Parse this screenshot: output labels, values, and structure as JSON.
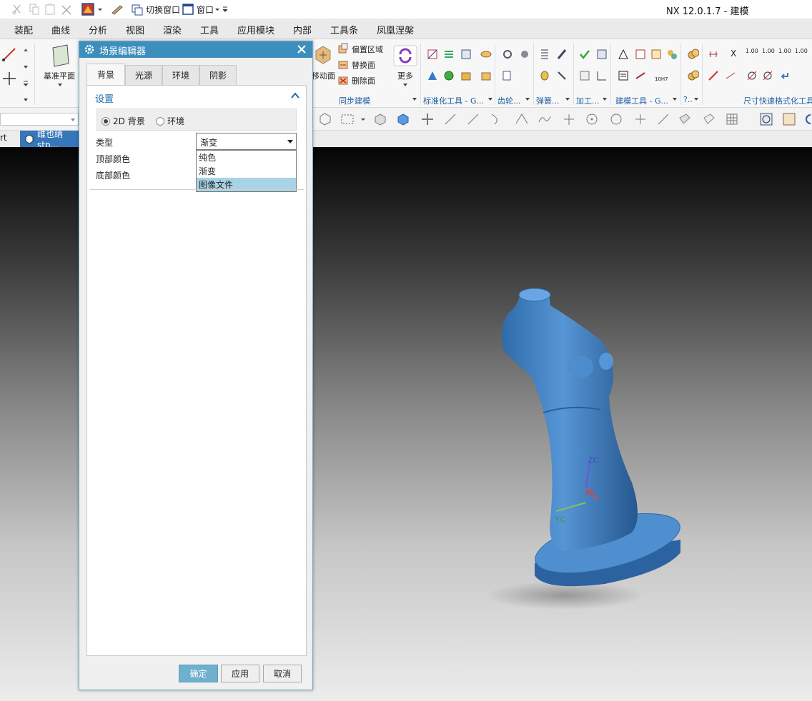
{
  "app": {
    "title": "NX 12.0.1.7 - 建模"
  },
  "quick_access": {
    "switch_window": "切换窗口",
    "window_menu": "窗口"
  },
  "ribbon_tabs": [
    {
      "label": "装配"
    },
    {
      "label": "曲线"
    },
    {
      "label": "分析"
    },
    {
      "label": "视图"
    },
    {
      "label": "渲染"
    },
    {
      "label": "工具"
    },
    {
      "label": "应用模块"
    },
    {
      "label": "内部"
    },
    {
      "label": "工具条"
    },
    {
      "label": "凤凰涅槃"
    }
  ],
  "ribbon": {
    "datum_plane": "基准平面",
    "move_face_partial": "移动面",
    "offset_region": "偏置区域",
    "replace_face": "替换面",
    "delete_face": "删除面",
    "more": "更多",
    "groups": [
      {
        "label": "同步建模"
      },
      {
        "label": "标准化工具 - G..."
      },
      {
        "label": "齿轮..."
      },
      {
        "label": "弹簧..."
      },
      {
        "label": "加工..."
      },
      {
        "label": "建模工具 - G..."
      },
      {
        "label": "?.."
      },
      {
        "label": "尺寸快速格式化工具"
      }
    ],
    "format_samples": [
      "1.00",
      "1.00",
      "1.00",
      "1.00"
    ],
    "tol_sample": "10H7",
    "x_label": "X"
  },
  "doc_tabs": {
    "left_partial": "rt",
    "active": "维也纳stp..."
  },
  "viewport": {
    "axes": {
      "z": "ZC",
      "x": "XC",
      "y": "YC"
    }
  },
  "dialog": {
    "title": "场景编辑器",
    "tabs": [
      {
        "label": "背景"
      },
      {
        "label": "光源"
      },
      {
        "label": "环境"
      },
      {
        "label": "阴影"
      }
    ],
    "section": {
      "title": "设置"
    },
    "radio": {
      "opt_2d": "2D 背景",
      "opt_env": "环境",
      "selected": "2D 背景"
    },
    "type": {
      "label": "类型",
      "value": "渐变",
      "options": [
        "纯色",
        "渐变",
        "图像文件"
      ],
      "highlighted": "图像文件"
    },
    "top_color_label": "顶部颜色",
    "bottom_color_label": "底部颜色",
    "buttons": {
      "ok": "确定",
      "apply": "应用",
      "cancel": "取消"
    }
  },
  "colors": {
    "accent": "#3c8ebc",
    "model": "#3f7fc4",
    "highlight": "#a7d3e6",
    "ok_button": "#6fb0cf"
  }
}
